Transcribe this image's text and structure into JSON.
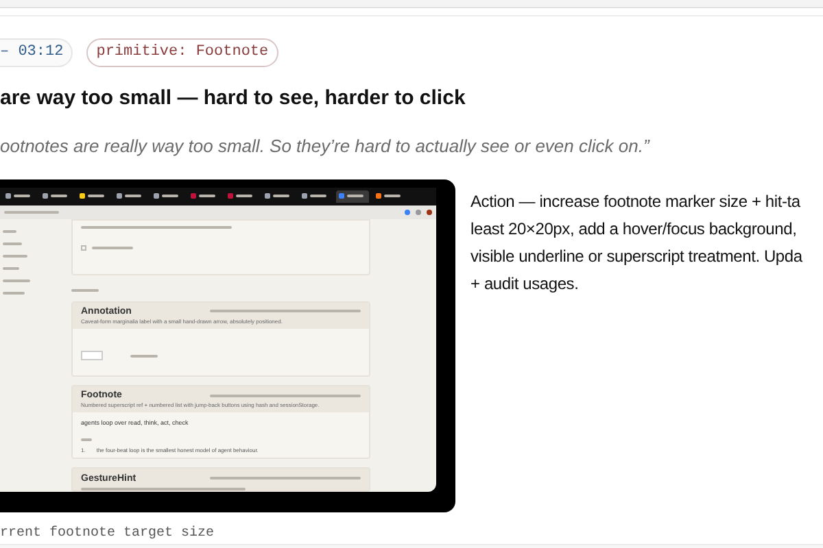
{
  "timestamp": "– 03:12",
  "tag": "primitive: Footnote",
  "heading": "are way too small — hard to see, harder to click",
  "quote": "ootnotes are really way too small. So they’re hard to actually see or even click on.”",
  "screenshot": {
    "checkbox_checked": false,
    "tabs": [
      {
        "selected": false,
        "color": "#9ca3af"
      },
      {
        "selected": false,
        "color": "#9ca3af"
      },
      {
        "selected": false,
        "color": "#facc15"
      },
      {
        "selected": false,
        "color": "#9ca3af"
      },
      {
        "selected": false,
        "color": "#9ca3af"
      },
      {
        "selected": false,
        "color": "#be123c"
      },
      {
        "selected": false,
        "color": "#be123c"
      },
      {
        "selected": false,
        "color": "#9ca3af"
      },
      {
        "selected": false,
        "color": "#9ca3af"
      },
      {
        "selected": true,
        "color": "#3b82f6"
      },
      {
        "selected": false,
        "color": "#f97316"
      }
    ],
    "cards": [
      {
        "title": "Annotation",
        "description": "Caveat-form marginalia label with a small hand-drawn arrow, absolutely positioned.",
        "kind": "annotation"
      },
      {
        "title": "Footnote",
        "description": "Numbered superscript ref + numbered list with jump-back buttons using hash and sessionStorage.",
        "body": "agents loop over read, think, act, check",
        "marker": "1.",
        "note": "the four-beat loop is the smallest honest model of agent behaviour.",
        "kind": "footnote"
      },
      {
        "title": "GestureHint",
        "kind": "cut"
      }
    ]
  },
  "caption": "rrent footnote target size",
  "action_lines": [
    "Action — increase footnote marker size + hit-ta",
    "least 20×20px, add a hover/focus background,",
    "visible underline or superscript treatment. Upda",
    "+ audit usages."
  ]
}
